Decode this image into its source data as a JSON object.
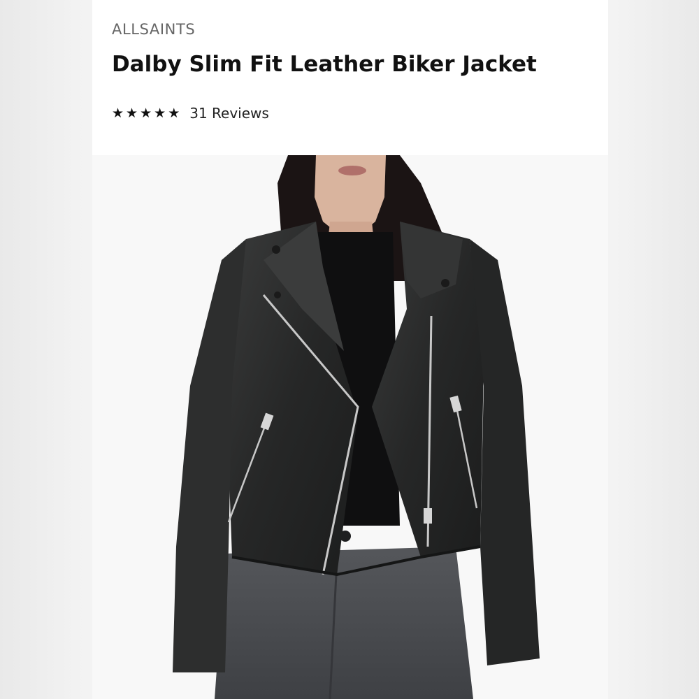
{
  "listing": {
    "brand": "ALLSAINTS",
    "title": "Dalby Slim Fit Leather Biker Jacket",
    "rating": {
      "stars": 5,
      "star_glyph": "★",
      "reviews_label": "31 Reviews"
    },
    "image": {
      "subject": "product-photo-model-wearing-black-leather-biker-jacket"
    }
  },
  "colors": {
    "text_primary": "#111111",
    "text_brand": "#666666",
    "jacket": "#2a2b2b",
    "jeans": "#4a4b4e",
    "zipper": "#c8c8c8"
  }
}
